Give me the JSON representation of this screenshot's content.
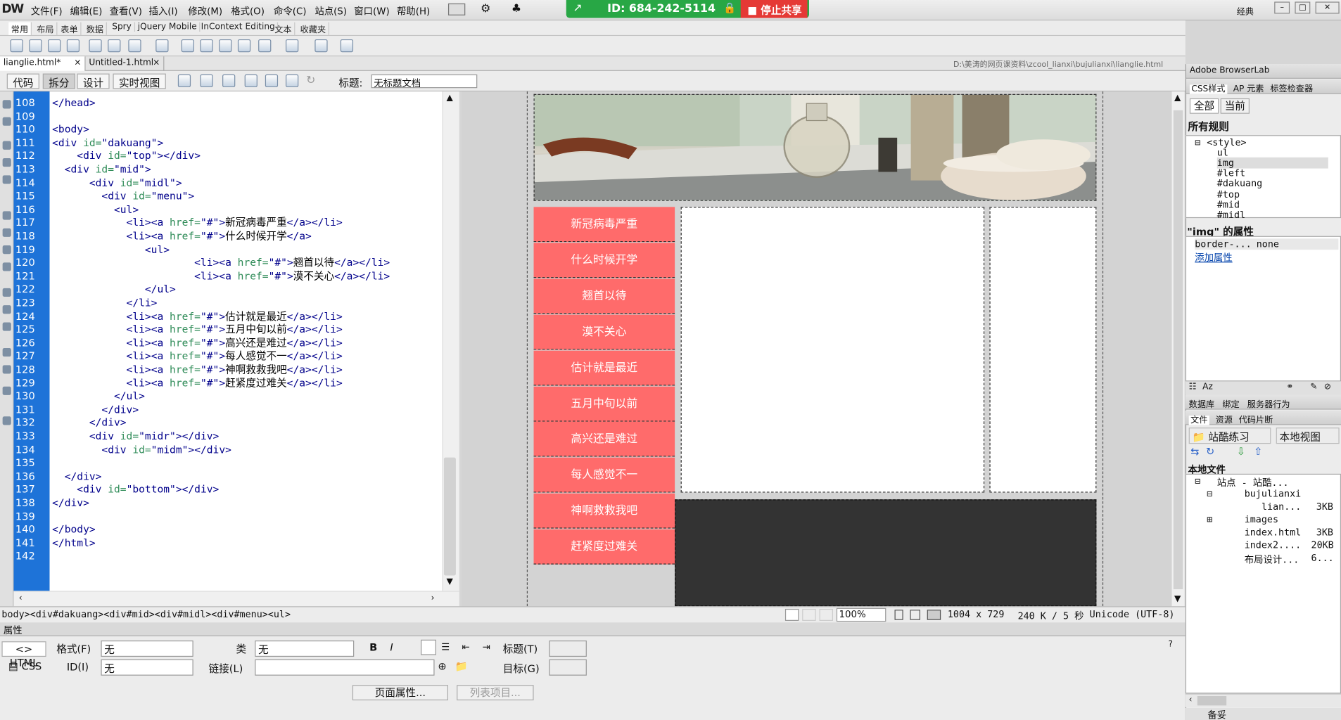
{
  "app": {
    "logo": "DW",
    "mode": "经典"
  },
  "menu": [
    "文件(F)",
    "编辑(E)",
    "查看(V)",
    "插入(I)",
    "修改(M)",
    "格式(O)",
    "命令(C)",
    "站点(S)",
    "窗口(W)",
    "帮助(H)"
  ],
  "share": {
    "id_label": "ID: 684-242-5114",
    "stop_label": "停止共享"
  },
  "insert_tabs": [
    "常用",
    "布局",
    "表单",
    "数据",
    "Spry",
    "jQuery Mobile",
    "InContext Editing",
    "文本",
    "收藏夹"
  ],
  "doc_tabs": [
    "lianglie.html*",
    "Untitled-1.html"
  ],
  "doc_path": "D:\\美涛的网页课资料\\zcool_lianxi\\bujulianxi\\lianglie.html",
  "view_buttons": [
    "代码",
    "拆分",
    "设计",
    "实时视图"
  ],
  "title_label": "标题:",
  "title_value": "无标题文档",
  "code_lines": [
    {
      "n": "108",
      "t": "</head>"
    },
    {
      "n": "109",
      "t": ""
    },
    {
      "n": "110",
      "t": "<body>"
    },
    {
      "n": "111",
      "t": "<div id=\"dakuang\">"
    },
    {
      "n": "112",
      "t": "    <div id=\"top\"></div>"
    },
    {
      "n": "113",
      "t": "  <div id=\"mid\">"
    },
    {
      "n": "114",
      "t": "      <div id=\"midl\">"
    },
    {
      "n": "115",
      "t": "        <div id=\"menu\">"
    },
    {
      "n": "116",
      "t": "          <ul>"
    },
    {
      "n": "117",
      "t": "            <li><a href=\"#\">新冠病毒严重</a></li>"
    },
    {
      "n": "118",
      "t": "            <li><a href=\"#\">什么时候开学</a>"
    },
    {
      "n": "119",
      "t": "               <ul>"
    },
    {
      "n": "120",
      "t": "                       <li><a href=\"#\">翘首以待</a></li>"
    },
    {
      "n": "121",
      "t": "                       <li><a href=\"#\">漠不关心</a></li>"
    },
    {
      "n": "122",
      "t": "               </ul>"
    },
    {
      "n": "123",
      "t": "            </li>"
    },
    {
      "n": "124",
      "t": "            <li><a href=\"#\">估计就是最近</a></li>"
    },
    {
      "n": "125",
      "t": "            <li><a href=\"#\">五月中旬以前</a></li>"
    },
    {
      "n": "126",
      "t": "            <li><a href=\"#\">高兴还是难过</a></li>"
    },
    {
      "n": "127",
      "t": "            <li><a href=\"#\">每人感觉不一</a></li>"
    },
    {
      "n": "128",
      "t": "            <li><a href=\"#\">神啊救救我吧</a></li>"
    },
    {
      "n": "129",
      "t": "            <li><a href=\"#\">赶紧度过难关</a></li>"
    },
    {
      "n": "130",
      "t": "          </ul>"
    },
    {
      "n": "131",
      "t": "        </div>"
    },
    {
      "n": "132",
      "t": "      </div>"
    },
    {
      "n": "133",
      "t": "      <div id=\"midr\"></div>"
    },
    {
      "n": "134",
      "t": "        <div id=\"midm\"></div>"
    },
    {
      "n": "135",
      "t": ""
    },
    {
      "n": "136",
      "t": "  </div>"
    },
    {
      "n": "137",
      "t": "    <div id=\"bottom\"></div>"
    },
    {
      "n": "138",
      "t": "</div>"
    },
    {
      "n": "139",
      "t": ""
    },
    {
      "n": "140",
      "t": "</body>"
    },
    {
      "n": "141",
      "t": "</html>"
    },
    {
      "n": "142",
      "t": ""
    }
  ],
  "menu_items": [
    "新冠病毒严重",
    "什么时候开学",
    "翘首以待",
    "漠不关心",
    "估计就是最近",
    "五月中旬以前",
    "高兴还是难过",
    "每人感觉不一",
    "神啊救救我吧",
    "赶紧度过难关"
  ],
  "status": {
    "breadcrumb": "body><div#dakuang><div#mid><div#midl><div#menu><ul>",
    "zoom": "100%",
    "size": "1004 x 729",
    "weight": "240 K / 5 秒",
    "encoding": "Unicode (UTF-8)"
  },
  "props": {
    "header": "属性",
    "html_btn": "HTML",
    "css_btn": "CSS",
    "format_label": "格式(F)",
    "format_value": "无",
    "id_label": "ID(I)",
    "id_value": "无",
    "class_label": "类",
    "class_value": "无",
    "link_label": "链接(L)",
    "title_label": "标题(T)",
    "target_label": "目标(G)",
    "page_props": "页面属性...",
    "list_item": "列表项目..."
  },
  "right_panel": {
    "browserlab": "Adobe BrowserLab",
    "tabs": [
      "CSS样式",
      "AP 元素",
      "标签检查器"
    ],
    "btn_all": "全部",
    "btn_current": "当前",
    "all_rules": "所有规则",
    "rules": [
      "<style>",
      "ul",
      "img",
      "#left",
      "#dakuang",
      "#top",
      "#mid",
      "#midl"
    ],
    "prop_title": "\"img\" 的属性",
    "prop_name": "border-...",
    "prop_value": "none",
    "add_prop": "添加属性",
    "tabs2": [
      "数据库",
      "绑定",
      "服务器行为"
    ],
    "tabs3": [
      "文件",
      "资源",
      "代码片断"
    ],
    "site": "站酷练习",
    "view": "本地视图",
    "local_files": "本地文件",
    "files": [
      {
        "name": "站点 - 站酷...",
        "size": ""
      },
      {
        "name": "bujulianxi",
        "size": ""
      },
      {
        "name": "lian...",
        "size": "3KB"
      },
      {
        "name": "images",
        "size": ""
      },
      {
        "name": "index.html",
        "size": "3KB"
      },
      {
        "name": "index2....",
        "size": "20KB"
      },
      {
        "name": "布局设计...",
        "size": "6..."
      }
    ],
    "footer": "备妥"
  }
}
